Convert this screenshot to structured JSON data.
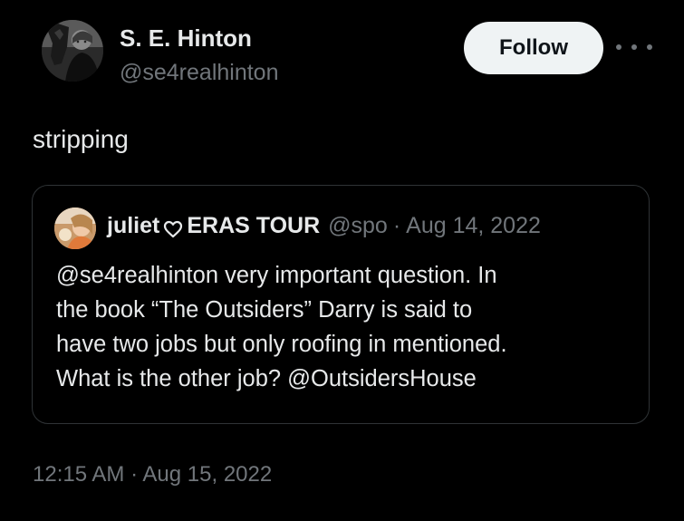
{
  "author": {
    "name": "S. E. Hinton",
    "handle": "@se4realhinton"
  },
  "actions": {
    "follow_label": "Follow"
  },
  "tweet": {
    "text": "stripping",
    "time": "12:15 AM",
    "separator": "·",
    "date": "Aug 15, 2022"
  },
  "quoted_tweet": {
    "name_part1": "juliet",
    "name_part2": "ERAS TOUR",
    "handle": "@spo",
    "separator": "·",
    "date": "Aug 14, 2022",
    "lines": [
      "@se4realhinton very important question. In",
      "the book “The Outsiders” Darry is said to",
      "have two jobs but only roofing in mentioned.",
      "What is the other job? @OutsidersHouse"
    ]
  },
  "icons": {
    "more": "more-horizontal-icon",
    "heart": "heart-outline-icon"
  },
  "colors": {
    "background": "#000000",
    "primary_text": "#e7e9ea",
    "secondary_text": "#71767b",
    "border": "#2f3336",
    "follow_bg": "#eff3f4"
  }
}
